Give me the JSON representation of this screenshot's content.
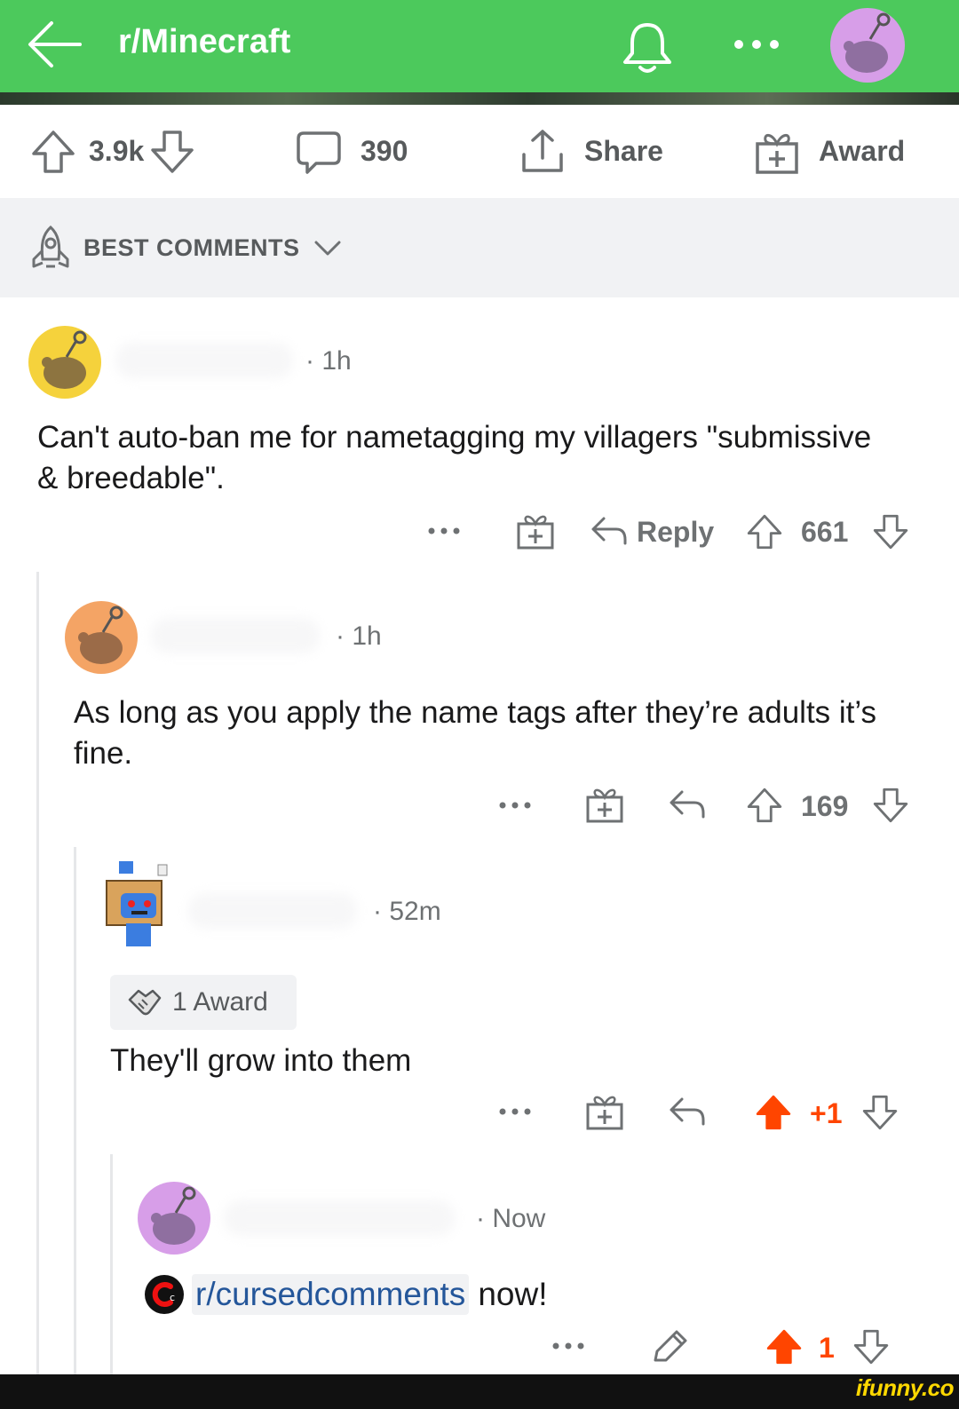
{
  "header": {
    "title": "r/Minecraft",
    "bg_color": "#4cc95c",
    "icons": [
      "back-arrow-icon",
      "bell-icon",
      "more-dots-icon",
      "snoo-avatar-icon"
    ]
  },
  "post_actions": {
    "score": "3.9k",
    "comments": "390",
    "share_label": "Share",
    "award_label": "Award"
  },
  "sort": {
    "label": "BEST COMMENTS"
  },
  "comments": [
    {
      "time": "1h",
      "body": "Can't auto-ban me for nametagging my villagers \"submissive & breedable\".",
      "reply_label": "Reply",
      "score": "661"
    },
    {
      "time": "1h",
      "body": "As long as you apply the name tags after they’re adults it’s fine.",
      "score": "169"
    },
    {
      "time": "52m",
      "award": "1 Award",
      "body": "They'll grow into them",
      "score": "+1",
      "upvoted": true
    },
    {
      "time": "Now",
      "subreddit": "r/cursedcomments",
      "body_after": "now!",
      "score": "1",
      "upvoted": true
    }
  ],
  "watermark": "ifunny.co",
  "colors": {
    "upvote": "#ff4500",
    "meta": "#6e7173",
    "link": "#24569a"
  }
}
